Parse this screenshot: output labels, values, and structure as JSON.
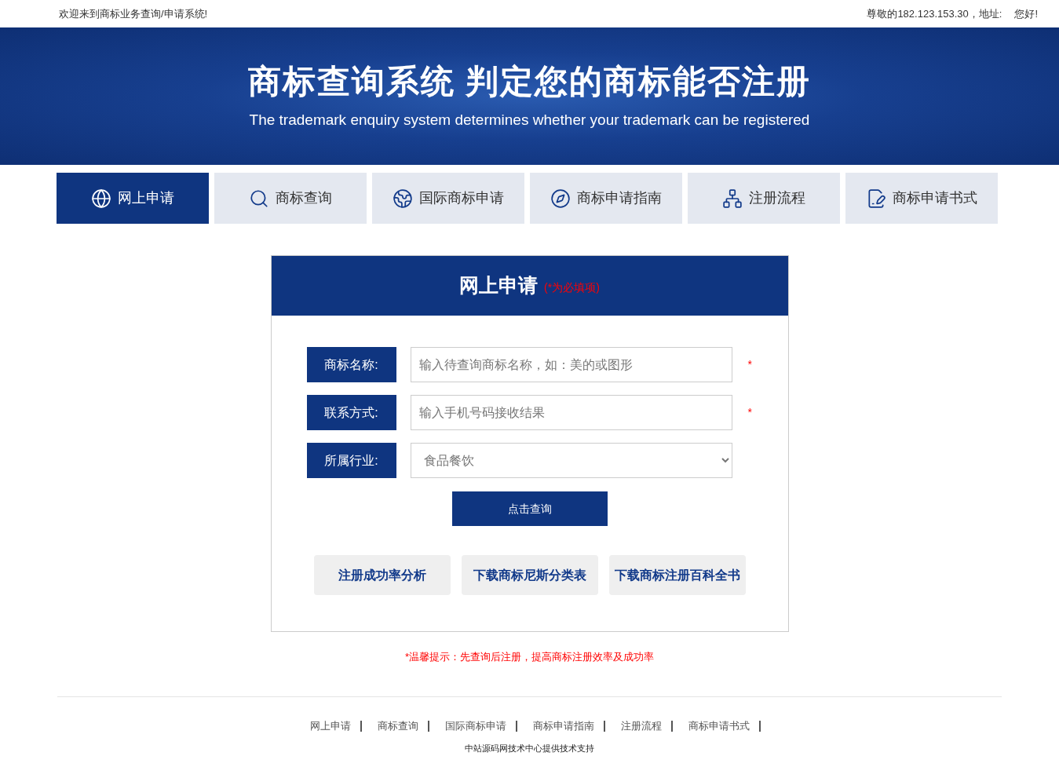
{
  "top_bar": {
    "welcome": "欢迎来到商标业务查询/申请系统!",
    "visitor": "尊敬的182.123.153.30，地址:",
    "greeting": "您好!"
  },
  "banner": {
    "title": "商标查询系统 判定您的商标能否注册",
    "subtitle": "The trademark enquiry system determines whether your trademark can be registered"
  },
  "tabs": [
    {
      "label": "网上申请",
      "kind": "globe",
      "selected": true
    },
    {
      "label": "商标查询",
      "kind": "search",
      "selected": false
    },
    {
      "label": "国际商标申请",
      "kind": "earth",
      "selected": false
    },
    {
      "label": "商标申请指南",
      "kind": "compass",
      "selected": false
    },
    {
      "label": "注册流程",
      "kind": "flow",
      "selected": false
    },
    {
      "label": "商标申请书式",
      "kind": "form",
      "selected": false
    }
  ],
  "form": {
    "title": "网上申请",
    "required_note": "(*为必填项)",
    "fields": [
      {
        "kind": "text",
        "label": "商标名称:",
        "placeholder": "输入待查询商标名称，如：美的或图形",
        "mark": "*"
      },
      {
        "kind": "text",
        "label": "联系方式:",
        "placeholder": "输入手机号码接收结果",
        "mark": "*"
      },
      {
        "kind": "select",
        "label": "所属行业:",
        "value": "食品餐饮"
      }
    ],
    "submit": "点击查询",
    "downloads": [
      "注册成功率分析",
      "下载商标尼斯分类表",
      "下载商标注册百科全书"
    ]
  },
  "tip": "*温馨提示：先查询后注册，提高商标注册效率及成功率",
  "footer": {
    "links": [
      "网上申请",
      "商标查询",
      "国际商标申请",
      "商标申请指南",
      "注册流程",
      "商标申请书式"
    ],
    "credit": "中站源码网技术中心提供技术支持"
  }
}
